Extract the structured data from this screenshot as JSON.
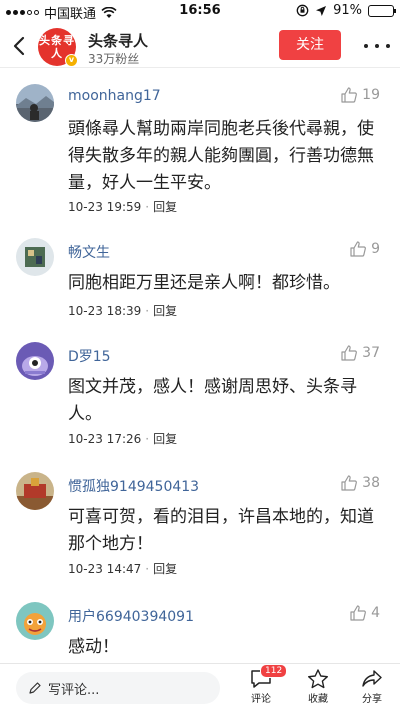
{
  "status_bar": {
    "carrier": "中国联通",
    "time": "16:56",
    "battery": "91%",
    "battery_level": 0.91
  },
  "header": {
    "account_name": "头条寻人",
    "followers": "33万粉丝",
    "avatar_text": "头条寻人",
    "follow_label": "关注"
  },
  "comments": [
    {
      "user": "moonhang17",
      "likes": "19",
      "text": "頭條尋人幫助兩岸同胞老兵後代尋親，使得失散多年的親人能夠團圓，行善功德無量，好人一生平安。",
      "time": "10-23 19:59",
      "reply_label": "回复"
    },
    {
      "user": "畅文生",
      "likes": "9",
      "text": "同胞相距万里还是亲人啊！都珍惜。",
      "time": "10-23 18:39",
      "reply_label": "回复"
    },
    {
      "user": "D罗15",
      "likes": "37",
      "text": "图文并茂，感人！感谢周思妤、头条寻人。",
      "time": "10-23 17:26",
      "reply_label": "回复"
    },
    {
      "user": "惯孤独9149450413",
      "likes": "38",
      "text": "可喜可贺，看的泪目，许昌本地的，知道那个地方！",
      "time": "10-23 14:47",
      "reply_label": "回复"
    },
    {
      "user": "用户66940394091",
      "likes": "4",
      "text": "感动！",
      "time": "",
      "reply_label": ""
    }
  ],
  "bottom_bar": {
    "write_placeholder": "写评论...",
    "comment_label": "评论",
    "comment_count": "112",
    "favorite_label": "收藏",
    "share_label": "分享"
  }
}
